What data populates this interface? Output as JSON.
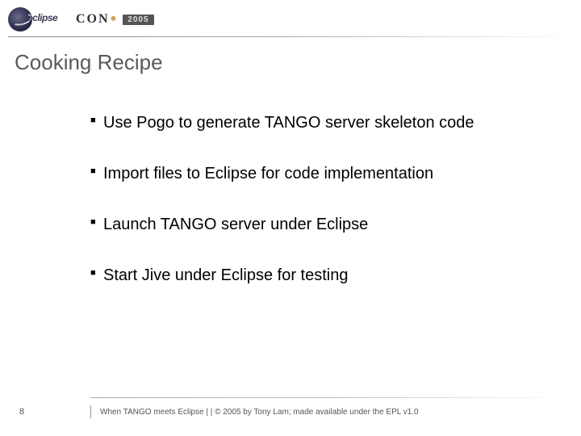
{
  "header": {
    "eclipse_text": "eclipse",
    "con_text": "CON",
    "year": "2005"
  },
  "slide": {
    "title": "Cooking Recipe",
    "bullets": [
      "Use Pogo to generate TANGO server skeleton code",
      "Import files to Eclipse for code implementation",
      "Launch TANGO server under Eclipse",
      "Start Jive under Eclipse for testing"
    ]
  },
  "footer": {
    "page_number": "8",
    "text": "When TANGO meets Eclipse  |    |  © 2005 by Tony Lam; made available under the EPL v1.0"
  }
}
